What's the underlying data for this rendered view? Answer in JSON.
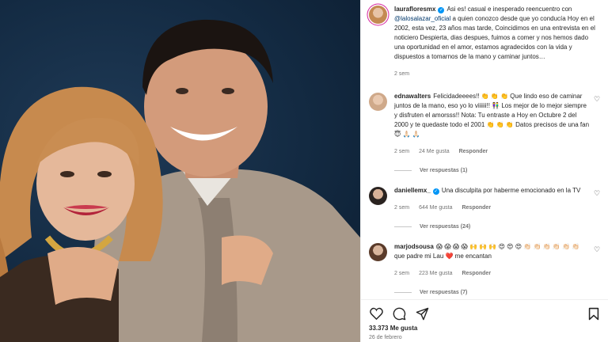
{
  "post": {
    "author": "laurafloresmx",
    "caption_pre": "Asi es! casual e inesperado reencuentro con ",
    "mention": "@lalosalazar_oficial",
    "caption_post": " a quien conozco desde que yo conducía Hoy en el 2002, esta vez, 23 años mas tarde, Coincidimos en una entrevista en el noticiero Despierta, dias despues, fuimos a comer y nos hemos dado una oportunidad en el amor, estamos agradecidos con la vida y dispuestos a tomarnos de la mano y caminar juntos…",
    "age": "2 sem"
  },
  "comments": [
    {
      "user": "ednawalters",
      "text": "Felicidadeeees!! 👏 👏 👏 Que lindo eso de caminar juntos de la mano, eso yo lo viiiiii!! 👫 Los mejor de lo mejor siempre y disfruten el amorsss!! Nota: Tu entraste a Hoy en Octubre 2 del 2000 y te quedaste todo el 2001 👏 👏 👏 Datos precisos de una fan 😇 🙏🏻 🙏🏻",
      "age": "2 sem",
      "likes": "24 Me gusta",
      "reply": "Responder",
      "view_replies": "Ver respuestas (1)"
    },
    {
      "user": "daniellemx_",
      "text": "Una disculpita por haberme emocionado en la TV",
      "age": "2 sem",
      "likes": "644 Me gusta",
      "reply": "Responder",
      "view_replies": "Ver respuestas (24)"
    },
    {
      "user": "marjodsousa",
      "text": "😱 😱 😱 😱 🙌 🙌 🙌 😍 😍 😍 👏🏻 👏🏻 👏🏻 👏🏻 👏🏻 👏🏻 que padre mi Lau ❤️ me encantan",
      "age": "2 sem",
      "likes": "223 Me gusta",
      "reply": "Responder",
      "view_replies": "Ver respuestas (7)"
    }
  ],
  "footer": {
    "likes": "33.373 Me gusta",
    "date": "26 de febrero"
  },
  "icons": {
    "like": "heart-icon",
    "comment": "comment-icon",
    "share": "share-icon",
    "save": "bookmark-icon"
  },
  "colors": {
    "mention": "#00376b",
    "verified": "#0095f6",
    "muted": "#737373",
    "photo_bg": "#132a42"
  }
}
